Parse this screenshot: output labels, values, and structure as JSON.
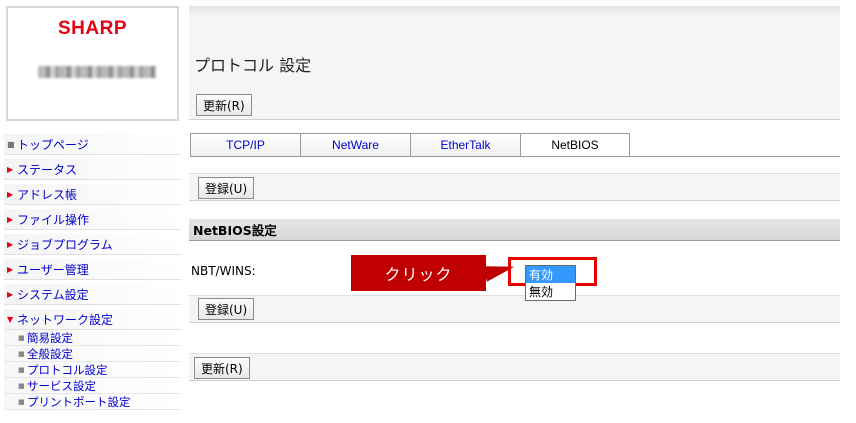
{
  "logo": {
    "brand": "SHARP"
  },
  "sidebar": {
    "items": [
      {
        "label": "トップページ",
        "marker": "square"
      },
      {
        "label": "ステータス",
        "marker": "triangle"
      },
      {
        "label": "アドレス帳",
        "marker": "triangle"
      },
      {
        "label": "ファイル操作",
        "marker": "triangle"
      },
      {
        "label": "ジョブプログラム",
        "marker": "triangle"
      },
      {
        "label": "ユーザー管理",
        "marker": "triangle"
      },
      {
        "label": "システム設定",
        "marker": "triangle"
      },
      {
        "label": "ネットワーク設定",
        "marker": "triangle-down"
      }
    ],
    "subitems": [
      {
        "label": "簡易設定"
      },
      {
        "label": "全般設定"
      },
      {
        "label": "プロトコル設定"
      },
      {
        "label": "サービス設定"
      },
      {
        "label": "プリントポート設定"
      }
    ]
  },
  "header": {
    "title": "プロトコル 設定",
    "refresh_label": "更新(R)"
  },
  "tabs": [
    {
      "label": "TCP/IP",
      "active": false
    },
    {
      "label": "NetWare",
      "active": false
    },
    {
      "label": "EtherTalk",
      "active": false
    },
    {
      "label": "NetBIOS",
      "active": true
    }
  ],
  "form": {
    "register_label": "登録(U)",
    "section_title": "NetBIOS設定",
    "nbt_label": "NBT/WINS:",
    "nbt_options": [
      "有効",
      "無効"
    ],
    "nbt_selected": "有効"
  },
  "footer": {
    "refresh_label": "更新(R)"
  },
  "annotation": {
    "callout_text": "クリック"
  },
  "colors": {
    "brand": "#e60012",
    "link": "#0000cc",
    "callout": "#c00000",
    "selection": "#3399ff"
  }
}
